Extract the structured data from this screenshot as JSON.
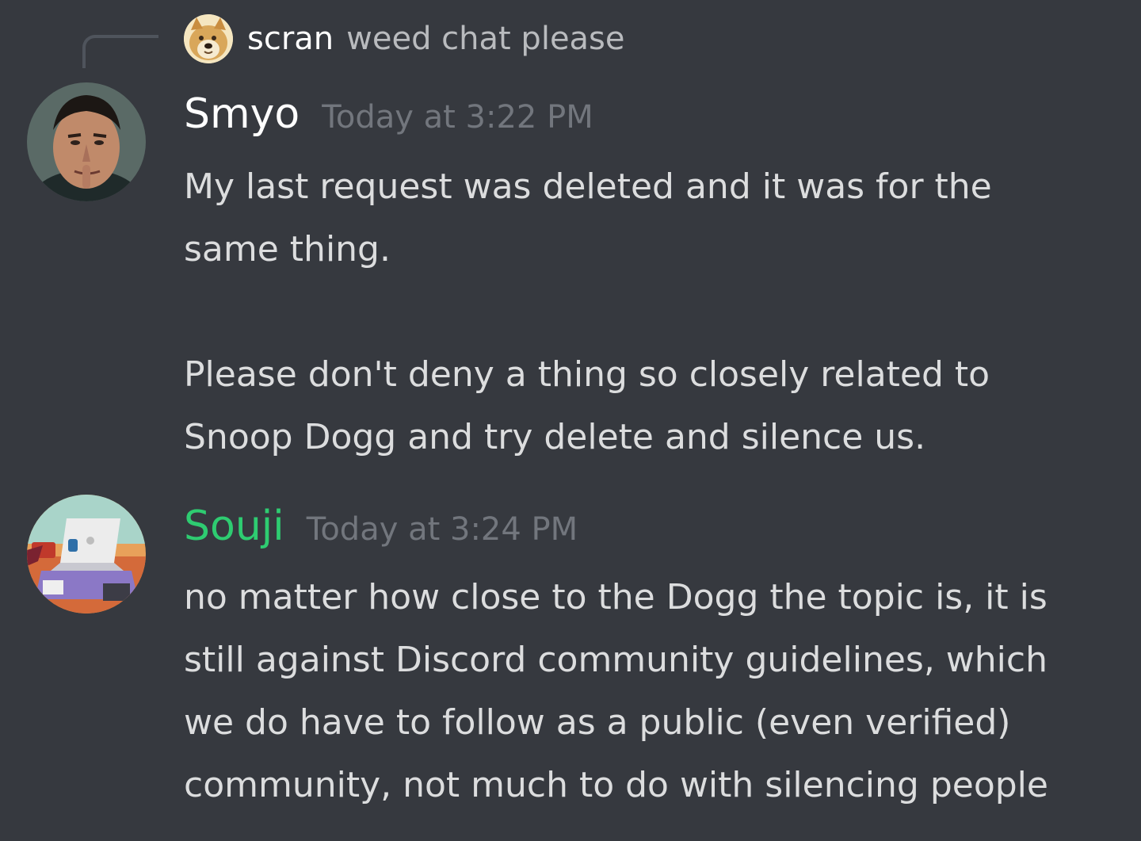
{
  "reply": {
    "author": "scran",
    "text": "weed chat please",
    "avatar_icon": "doge-avatar"
  },
  "messages": [
    {
      "author": "Smyo",
      "author_color": "#ffffff",
      "timestamp": "Today at 3:22 PM",
      "avatar_icon": "man-portrait-avatar",
      "paragraphs": [
        [
          "My last request was deleted and it was for the",
          "same thing."
        ],
        [
          "Please don't deny a thing so closely related to",
          "Snoop Dogg and try delete and silence us."
        ]
      ]
    },
    {
      "author": "Souji",
      "author_color": "#2ecc71",
      "timestamp": "Today at 3:24 PM",
      "avatar_icon": "desk-laptop-avatar",
      "paragraphs": [
        [
          "no matter how close to the Dogg the topic is, it is",
          "still against Discord community guidelines, which",
          "we do have to follow as a public (even verified)",
          "community, not much to do with silencing people"
        ]
      ]
    }
  ],
  "theme": {
    "background": "#36393f",
    "text": "#dcddde",
    "muted": "#72767d"
  }
}
